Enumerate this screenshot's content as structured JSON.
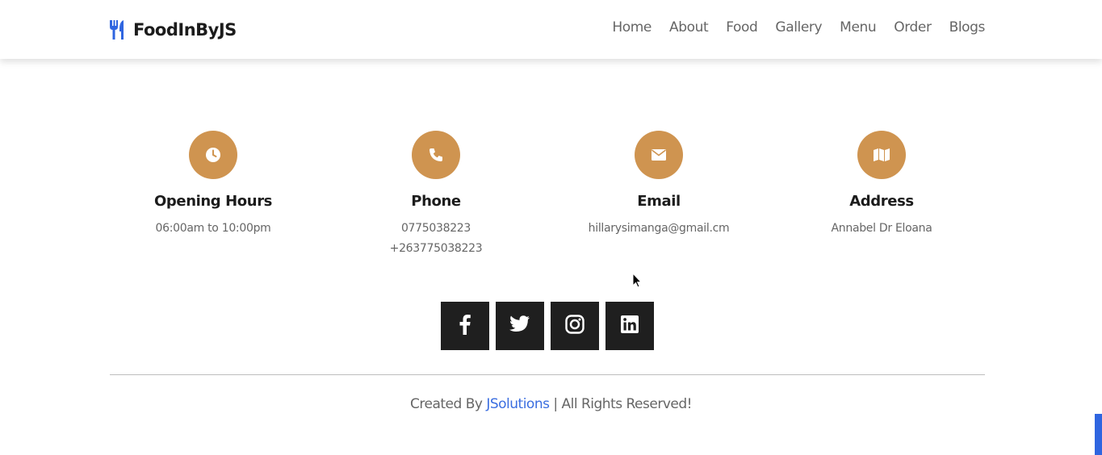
{
  "header": {
    "brand": "FoodInByJS",
    "brand_icon": "utensils-icon",
    "nav": [
      "Home",
      "About",
      "Food",
      "Gallery",
      "Menu",
      "Order",
      "Blogs"
    ]
  },
  "info": [
    {
      "icon": "clock-icon",
      "title": "Opening Hours",
      "lines": [
        "06:00am to 10:00pm"
      ]
    },
    {
      "icon": "phone-icon",
      "title": "Phone",
      "lines": [
        "0775038223",
        "+263775038223"
      ]
    },
    {
      "icon": "envelope-icon",
      "title": "Email",
      "lines": [
        "hillarysimanga@gmail.cm"
      ]
    },
    {
      "icon": "map-icon",
      "title": "Address",
      "lines": [
        "Annabel Dr Eloana"
      ]
    }
  ],
  "share": [
    {
      "icon": "facebook-icon"
    },
    {
      "icon": "twitter-icon"
    },
    {
      "icon": "instagram-icon"
    },
    {
      "icon": "linkedin-icon"
    }
  ],
  "footer": {
    "credit_prefix": "Created By ",
    "credit_link": "JSolutions",
    "credit_suffix": " | All Rights Reserved!"
  },
  "colors": {
    "accent": "#cf9450",
    "brand_blue": "#3b6ee0",
    "dark": "#1f1f1f"
  }
}
